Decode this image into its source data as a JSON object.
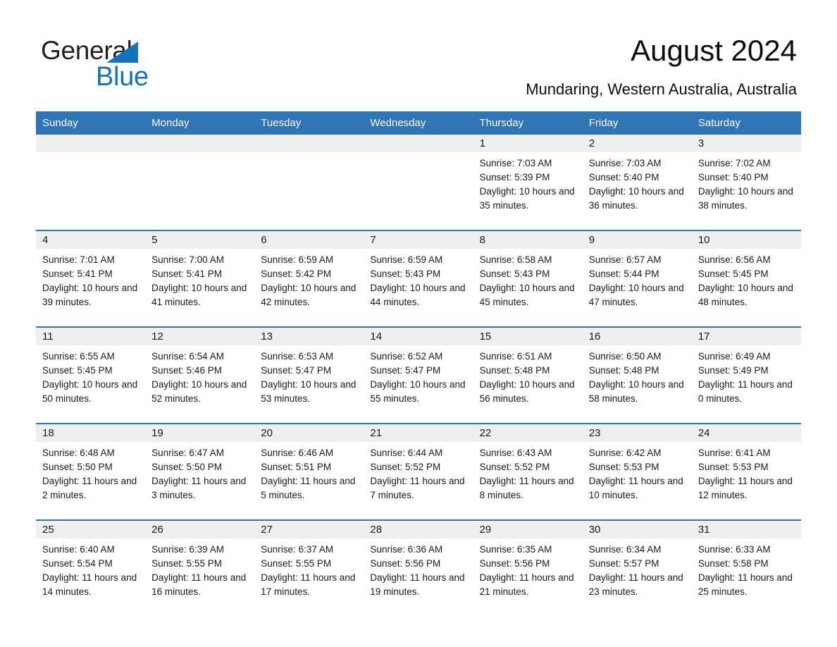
{
  "brand": {
    "name_part1": "General",
    "name_part2": "Blue",
    "triangle_color": "#1374bb",
    "accent_color": "#2f74b5"
  },
  "header": {
    "title": "August 2024",
    "subtitle": "Mundaring, Western Australia, Australia"
  },
  "calendar": {
    "weekday_headers": [
      "Sunday",
      "Monday",
      "Tuesday",
      "Wednesday",
      "Thursday",
      "Friday",
      "Saturday"
    ],
    "header_bg": "#2f74b5",
    "daynum_bg": "#efefef",
    "weeks": [
      [
        {
          "day": "",
          "sunrise": "",
          "sunset": "",
          "daylight": ""
        },
        {
          "day": "",
          "sunrise": "",
          "sunset": "",
          "daylight": ""
        },
        {
          "day": "",
          "sunrise": "",
          "sunset": "",
          "daylight": ""
        },
        {
          "day": "",
          "sunrise": "",
          "sunset": "",
          "daylight": ""
        },
        {
          "day": "1",
          "sunrise": "Sunrise: 7:03 AM",
          "sunset": "Sunset: 5:39 PM",
          "daylight": "Daylight: 10 hours and 35 minutes."
        },
        {
          "day": "2",
          "sunrise": "Sunrise: 7:03 AM",
          "sunset": "Sunset: 5:40 PM",
          "daylight": "Daylight: 10 hours and 36 minutes."
        },
        {
          "day": "3",
          "sunrise": "Sunrise: 7:02 AM",
          "sunset": "Sunset: 5:40 PM",
          "daylight": "Daylight: 10 hours and 38 minutes."
        }
      ],
      [
        {
          "day": "4",
          "sunrise": "Sunrise: 7:01 AM",
          "sunset": "Sunset: 5:41 PM",
          "daylight": "Daylight: 10 hours and 39 minutes."
        },
        {
          "day": "5",
          "sunrise": "Sunrise: 7:00 AM",
          "sunset": "Sunset: 5:41 PM",
          "daylight": "Daylight: 10 hours and 41 minutes."
        },
        {
          "day": "6",
          "sunrise": "Sunrise: 6:59 AM",
          "sunset": "Sunset: 5:42 PM",
          "daylight": "Daylight: 10 hours and 42 minutes."
        },
        {
          "day": "7",
          "sunrise": "Sunrise: 6:59 AM",
          "sunset": "Sunset: 5:43 PM",
          "daylight": "Daylight: 10 hours and 44 minutes."
        },
        {
          "day": "8",
          "sunrise": "Sunrise: 6:58 AM",
          "sunset": "Sunset: 5:43 PM",
          "daylight": "Daylight: 10 hours and 45 minutes."
        },
        {
          "day": "9",
          "sunrise": "Sunrise: 6:57 AM",
          "sunset": "Sunset: 5:44 PM",
          "daylight": "Daylight: 10 hours and 47 minutes."
        },
        {
          "day": "10",
          "sunrise": "Sunrise: 6:56 AM",
          "sunset": "Sunset: 5:45 PM",
          "daylight": "Daylight: 10 hours and 48 minutes."
        }
      ],
      [
        {
          "day": "11",
          "sunrise": "Sunrise: 6:55 AM",
          "sunset": "Sunset: 5:45 PM",
          "daylight": "Daylight: 10 hours and 50 minutes."
        },
        {
          "day": "12",
          "sunrise": "Sunrise: 6:54 AM",
          "sunset": "Sunset: 5:46 PM",
          "daylight": "Daylight: 10 hours and 52 minutes."
        },
        {
          "day": "13",
          "sunrise": "Sunrise: 6:53 AM",
          "sunset": "Sunset: 5:47 PM",
          "daylight": "Daylight: 10 hours and 53 minutes."
        },
        {
          "day": "14",
          "sunrise": "Sunrise: 6:52 AM",
          "sunset": "Sunset: 5:47 PM",
          "daylight": "Daylight: 10 hours and 55 minutes."
        },
        {
          "day": "15",
          "sunrise": "Sunrise: 6:51 AM",
          "sunset": "Sunset: 5:48 PM",
          "daylight": "Daylight: 10 hours and 56 minutes."
        },
        {
          "day": "16",
          "sunrise": "Sunrise: 6:50 AM",
          "sunset": "Sunset: 5:48 PM",
          "daylight": "Daylight: 10 hours and 58 minutes."
        },
        {
          "day": "17",
          "sunrise": "Sunrise: 6:49 AM",
          "sunset": "Sunset: 5:49 PM",
          "daylight": "Daylight: 11 hours and 0 minutes."
        }
      ],
      [
        {
          "day": "18",
          "sunrise": "Sunrise: 6:48 AM",
          "sunset": "Sunset: 5:50 PM",
          "daylight": "Daylight: 11 hours and 2 minutes."
        },
        {
          "day": "19",
          "sunrise": "Sunrise: 6:47 AM",
          "sunset": "Sunset: 5:50 PM",
          "daylight": "Daylight: 11 hours and 3 minutes."
        },
        {
          "day": "20",
          "sunrise": "Sunrise: 6:46 AM",
          "sunset": "Sunset: 5:51 PM",
          "daylight": "Daylight: 11 hours and 5 minutes."
        },
        {
          "day": "21",
          "sunrise": "Sunrise: 6:44 AM",
          "sunset": "Sunset: 5:52 PM",
          "daylight": "Daylight: 11 hours and 7 minutes."
        },
        {
          "day": "22",
          "sunrise": "Sunrise: 6:43 AM",
          "sunset": "Sunset: 5:52 PM",
          "daylight": "Daylight: 11 hours and 8 minutes."
        },
        {
          "day": "23",
          "sunrise": "Sunrise: 6:42 AM",
          "sunset": "Sunset: 5:53 PM",
          "daylight": "Daylight: 11 hours and 10 minutes."
        },
        {
          "day": "24",
          "sunrise": "Sunrise: 6:41 AM",
          "sunset": "Sunset: 5:53 PM",
          "daylight": "Daylight: 11 hours and 12 minutes."
        }
      ],
      [
        {
          "day": "25",
          "sunrise": "Sunrise: 6:40 AM",
          "sunset": "Sunset: 5:54 PM",
          "daylight": "Daylight: 11 hours and 14 minutes."
        },
        {
          "day": "26",
          "sunrise": "Sunrise: 6:39 AM",
          "sunset": "Sunset: 5:55 PM",
          "daylight": "Daylight: 11 hours and 16 minutes."
        },
        {
          "day": "27",
          "sunrise": "Sunrise: 6:37 AM",
          "sunset": "Sunset: 5:55 PM",
          "daylight": "Daylight: 11 hours and 17 minutes."
        },
        {
          "day": "28",
          "sunrise": "Sunrise: 6:36 AM",
          "sunset": "Sunset: 5:56 PM",
          "daylight": "Daylight: 11 hours and 19 minutes."
        },
        {
          "day": "29",
          "sunrise": "Sunrise: 6:35 AM",
          "sunset": "Sunset: 5:56 PM",
          "daylight": "Daylight: 11 hours and 21 minutes."
        },
        {
          "day": "30",
          "sunrise": "Sunrise: 6:34 AM",
          "sunset": "Sunset: 5:57 PM",
          "daylight": "Daylight: 11 hours and 23 minutes."
        },
        {
          "day": "31",
          "sunrise": "Sunrise: 6:33 AM",
          "sunset": "Sunset: 5:58 PM",
          "daylight": "Daylight: 11 hours and 25 minutes."
        }
      ]
    ]
  }
}
